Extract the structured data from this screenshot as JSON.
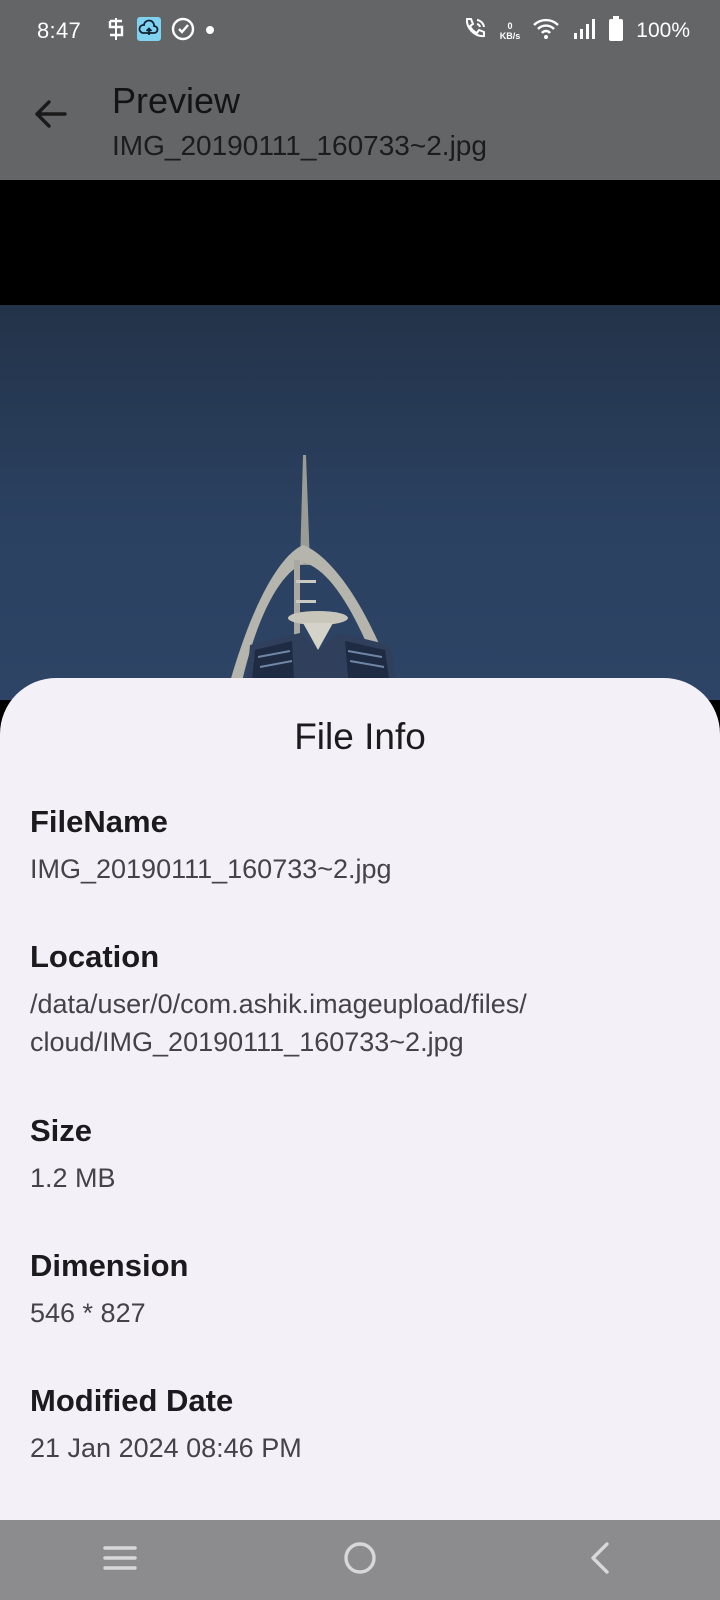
{
  "status_bar": {
    "time": "8:47",
    "left_icons": [
      "s-shield-icon",
      "cloud-upload-icon",
      "c-sync-icon",
      "dot-icon"
    ],
    "net_speed_value": "0",
    "net_speed_unit": "KB/s",
    "battery_percent": "100%"
  },
  "app_bar": {
    "title": "Preview",
    "subtitle": "IMG_20190111_160733~2.jpg"
  },
  "sheet": {
    "title": "File Info",
    "fields": [
      {
        "label": "FileName",
        "value": "IMG_20190111_160733~2.jpg"
      },
      {
        "label": "Location",
        "value": "/data/user/0/com.ashik.imageupload/files/",
        "value_line2": "cloud/IMG_20190111_160733~2.jpg"
      },
      {
        "label": "Size",
        "value": "1.2 MB"
      },
      {
        "label": "Dimension",
        "value": "546 * 827"
      },
      {
        "label": "Modified Date",
        "value": "21 Jan 2024 08:46 PM"
      }
    ]
  },
  "colors": {
    "scrim": "#646566",
    "sheet_bg": "#f4f0f7",
    "sky": "#2b4161",
    "nav_bar": "#8c8c8f"
  }
}
